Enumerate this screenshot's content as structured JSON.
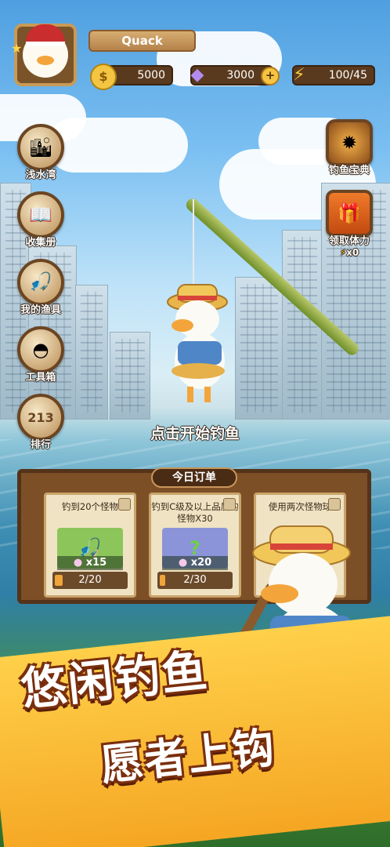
{
  "player": {
    "name": "Quack",
    "avatar_icon": "duck-santa-hat-icon"
  },
  "resources": {
    "coins": "5000",
    "gems": "3000",
    "energy": "100/45"
  },
  "left_menu": [
    {
      "label": "浅水湾",
      "icon": "city-pin-icon"
    },
    {
      "label": "收集册",
      "icon": "album-book-icon"
    },
    {
      "label": "我的渔具",
      "icon": "fishing-rod-icon"
    },
    {
      "label": "工具箱",
      "icon": "ball-toolbox-icon"
    },
    {
      "label": "排行",
      "icon": "podium-icon"
    }
  ],
  "right_menu": [
    {
      "label": "钓鱼宝典",
      "icon": "badge-compass-icon"
    },
    {
      "label": "领取体力",
      "icon": "gift-box-icon",
      "sub": "x0"
    }
  ],
  "prompt": "点击开始钓鱼",
  "orders": {
    "title": "今日订单",
    "cards": [
      {
        "title": "钓到20个怪物",
        "reward": "x15",
        "progress": "2/20",
        "fraction": 0.1
      },
      {
        "title": "钓到C级及以上品质的怪物X30",
        "reward": "x20",
        "progress": "2/30",
        "fraction": 0.0667
      },
      {
        "title": "使用两次怪物球",
        "reward": "",
        "progress": "",
        "fraction": 0
      }
    ]
  },
  "slogan": {
    "line1": "悠闲钓鱼",
    "line2": "愿者上钩"
  },
  "colors": {
    "banner": "#f5a623",
    "wood": "#7d4f27",
    "progress": "#f0a43a"
  }
}
